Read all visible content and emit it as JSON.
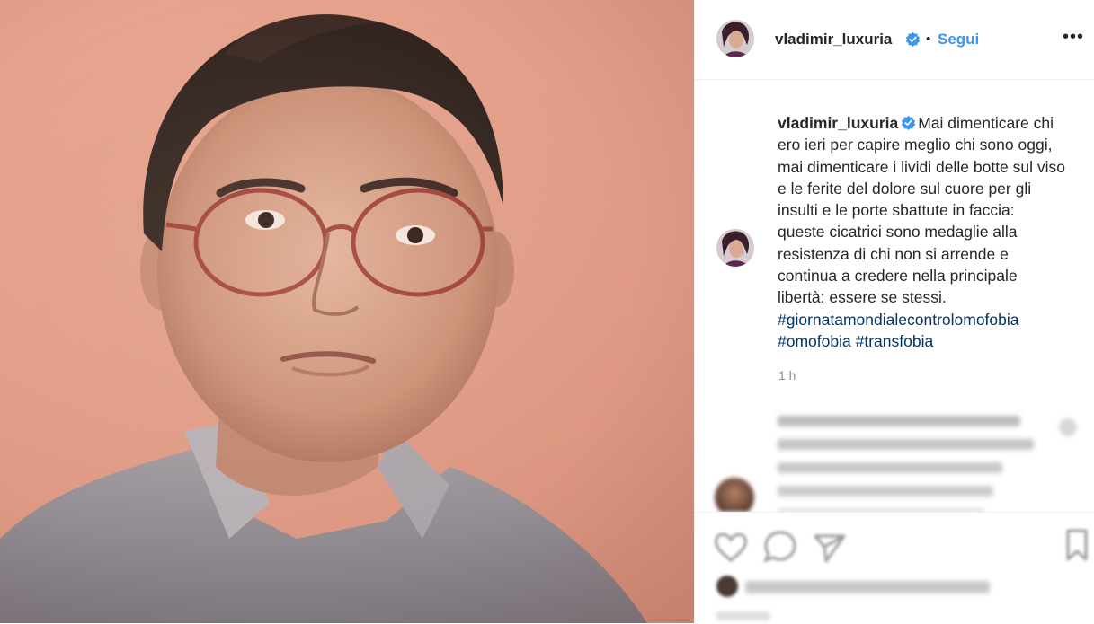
{
  "post": {
    "username": "vladimir_luxuria",
    "follow_label": "Segui",
    "separator": "•",
    "more_label": "•••",
    "caption_text": "Mai dimenticare chi ero ieri per capire meglio chi sono oggi, mai dimenticare i lividi delle botte sul viso e le ferite del dolore sul cuore per gli insulti e le porte sbattute in faccia: queste cicatrici sono medaglie alla resistenza di chi non si arrende e continua a credere nella principale libertà: essere se stessi.",
    "hashtags": [
      "#giornatamondialecontrolomofobia",
      "#omofobia",
      "#transfobia"
    ],
    "time_ago": "1 h"
  },
  "colors": {
    "link": "#003569",
    "follow": "#3897f0",
    "verified": "#3897f0"
  },
  "icons": [
    "verified-badge-icon",
    "more-options-icon",
    "heart-icon",
    "comment-icon",
    "share-icon",
    "bookmark-icon"
  ]
}
